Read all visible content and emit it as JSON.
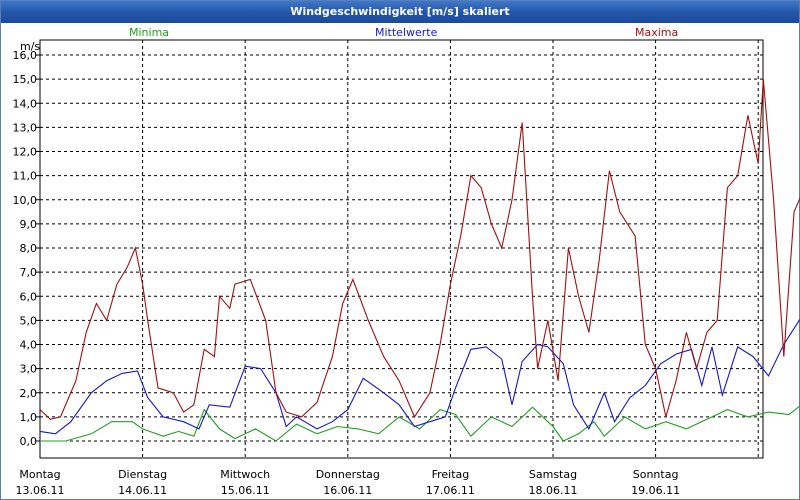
{
  "title": "Windgeschwindigkeit [m/s] skaliert",
  "colors": {
    "min": "#20a020",
    "mean": "#1818c8",
    "max": "#a01010",
    "grid": "#000000",
    "titlebar": "#2456a8"
  },
  "chart_data": {
    "type": "line",
    "title": "Windgeschwindigkeit [m/s] skaliert",
    "ylabel": "m/s",
    "ylim": [
      -0.8,
      16.5
    ],
    "yticks": [
      "0,0",
      "1,0",
      "2,0",
      "3,0",
      "4,0",
      "5,0",
      "6,0",
      "7,0",
      "8,0",
      "9,0",
      "10,0",
      "11,0",
      "12,0",
      "13,0",
      "14,0",
      "15,0",
      "16,0"
    ],
    "ytick_values": [
      0,
      1,
      2,
      3,
      4,
      5,
      6,
      7,
      8,
      9,
      10,
      11,
      12,
      13,
      14,
      15,
      16
    ],
    "days": [
      {
        "day": "Montag",
        "date": "13.06.11"
      },
      {
        "day": "Dienstag",
        "date": "14.06.11"
      },
      {
        "day": "Mittwoch",
        "date": "15.06.11"
      },
      {
        "day": "Donnerstag",
        "date": "16.06.11"
      },
      {
        "day": "Freitag",
        "date": "17.06.11"
      },
      {
        "day": "Samstag",
        "date": "18.06.11"
      },
      {
        "day": "Sonntag",
        "date": "19.06.11"
      }
    ],
    "x_unit": "days since Montag 13.06.11 00:00",
    "grid": true,
    "legend_position": "top",
    "series": [
      {
        "name": "Minima",
        "color": "#20a020",
        "points": [
          [
            0,
            0
          ],
          [
            0.25,
            0
          ],
          [
            0.5,
            0.3
          ],
          [
            0.7,
            0.8
          ],
          [
            0.9,
            0.8
          ],
          [
            1.0,
            0.5
          ],
          [
            1.2,
            0.2
          ],
          [
            1.35,
            0.4
          ],
          [
            1.5,
            0.2
          ],
          [
            1.6,
            1.3
          ],
          [
            1.75,
            0.5
          ],
          [
            1.9,
            0.1
          ],
          [
            2.1,
            0.5
          ],
          [
            2.3,
            0
          ],
          [
            2.5,
            0.7
          ],
          [
            2.7,
            0.3
          ],
          [
            2.9,
            0.6
          ],
          [
            3.1,
            0.5
          ],
          [
            3.3,
            0.3
          ],
          [
            3.5,
            1.0
          ],
          [
            3.7,
            0.5
          ],
          [
            3.9,
            1.3
          ],
          [
            4.05,
            1.1
          ],
          [
            4.2,
            0.2
          ],
          [
            4.4,
            1.0
          ],
          [
            4.6,
            0.6
          ],
          [
            4.8,
            1.4
          ],
          [
            5.0,
            0.6
          ],
          [
            5.1,
            0
          ],
          [
            5.25,
            0.3
          ],
          [
            5.4,
            0.8
          ],
          [
            5.5,
            0.2
          ],
          [
            5.7,
            1.0
          ],
          [
            5.9,
            0.5
          ],
          [
            6.1,
            0.8
          ],
          [
            6.3,
            0.5
          ],
          [
            6.5,
            0.9
          ],
          [
            6.7,
            1.3
          ],
          [
            6.9,
            1.0
          ],
          [
            7.1,
            1.2
          ],
          [
            7.3,
            1.1
          ],
          [
            7.45,
            1.6
          ],
          [
            7.6,
            1.5
          ]
        ]
      },
      {
        "name": "Mittelwerte",
        "color": "#1818c8",
        "points": [
          [
            0,
            0.4
          ],
          [
            0.15,
            0.3
          ],
          [
            0.3,
            0.8
          ],
          [
            0.5,
            2.0
          ],
          [
            0.65,
            2.5
          ],
          [
            0.8,
            2.8
          ],
          [
            0.95,
            2.9
          ],
          [
            1.05,
            1.8
          ],
          [
            1.2,
            1.0
          ],
          [
            1.4,
            0.8
          ],
          [
            1.55,
            0.5
          ],
          [
            1.65,
            1.5
          ],
          [
            1.85,
            1.4
          ],
          [
            2.0,
            3.1
          ],
          [
            2.15,
            3.0
          ],
          [
            2.3,
            2.0
          ],
          [
            2.4,
            0.6
          ],
          [
            2.5,
            1.0
          ],
          [
            2.7,
            0.5
          ],
          [
            2.85,
            0.8
          ],
          [
            3.0,
            1.3
          ],
          [
            3.15,
            2.6
          ],
          [
            3.35,
            2.0
          ],
          [
            3.5,
            1.5
          ],
          [
            3.65,
            0.6
          ],
          [
            3.8,
            0.8
          ],
          [
            3.95,
            1.0
          ],
          [
            4.05,
            2.2
          ],
          [
            4.2,
            3.8
          ],
          [
            4.35,
            3.9
          ],
          [
            4.5,
            3.4
          ],
          [
            4.6,
            1.5
          ],
          [
            4.7,
            3.3
          ],
          [
            4.85,
            4.0
          ],
          [
            4.95,
            3.9
          ],
          [
            5.1,
            3.2
          ],
          [
            5.2,
            1.5
          ],
          [
            5.35,
            0.5
          ],
          [
            5.5,
            2.0
          ],
          [
            5.6,
            0.8
          ],
          [
            5.75,
            1.8
          ],
          [
            5.9,
            2.3
          ],
          [
            6.05,
            3.2
          ],
          [
            6.2,
            3.6
          ],
          [
            6.35,
            3.8
          ],
          [
            6.45,
            2.3
          ],
          [
            6.55,
            3.9
          ],
          [
            6.65,
            1.9
          ],
          [
            6.8,
            3.9
          ],
          [
            6.95,
            3.5
          ],
          [
            7.1,
            2.7
          ],
          [
            7.25,
            4.0
          ],
          [
            7.4,
            5.0
          ],
          [
            7.55,
            5.5
          ],
          [
            7.65,
            3.9
          ],
          [
            7.8,
            4.5
          ],
          [
            7.95,
            4.8
          ],
          [
            8.1,
            3.7
          ]
        ]
      },
      {
        "name": "Maxima",
        "color": "#a01010",
        "points": [
          [
            0,
            1.3
          ],
          [
            0.1,
            0.9
          ],
          [
            0.2,
            1.0
          ],
          [
            0.35,
            2.5
          ],
          [
            0.45,
            4.5
          ],
          [
            0.55,
            5.7
          ],
          [
            0.65,
            5.0
          ],
          [
            0.75,
            6.5
          ],
          [
            0.85,
            7.2
          ],
          [
            0.93,
            8.0
          ],
          [
            1.0,
            6.5
          ],
          [
            1.05,
            5.0
          ],
          [
            1.15,
            2.2
          ],
          [
            1.3,
            2.0
          ],
          [
            1.4,
            1.2
          ],
          [
            1.5,
            1.5
          ],
          [
            1.6,
            3.8
          ],
          [
            1.7,
            3.5
          ],
          [
            1.75,
            6.0
          ],
          [
            1.85,
            5.5
          ],
          [
            1.9,
            6.5
          ],
          [
            2.05,
            6.7
          ],
          [
            2.2,
            5.0
          ],
          [
            2.3,
            2.0
          ],
          [
            2.4,
            1.2
          ],
          [
            2.55,
            1.0
          ],
          [
            2.7,
            1.6
          ],
          [
            2.85,
            3.5
          ],
          [
            2.95,
            5.7
          ],
          [
            3.05,
            6.7
          ],
          [
            3.2,
            5.0
          ],
          [
            3.35,
            3.5
          ],
          [
            3.5,
            2.5
          ],
          [
            3.65,
            1.0
          ],
          [
            3.8,
            2.0
          ],
          [
            3.9,
            4.0
          ],
          [
            4.0,
            6.5
          ],
          [
            4.1,
            8.5
          ],
          [
            4.2,
            11.0
          ],
          [
            4.3,
            10.5
          ],
          [
            4.4,
            9.0
          ],
          [
            4.5,
            8.0
          ],
          [
            4.6,
            10.0
          ],
          [
            4.7,
            13.2
          ],
          [
            4.8,
            6.0
          ],
          [
            4.85,
            3.0
          ],
          [
            4.95,
            5.0
          ],
          [
            5.05,
            2.5
          ],
          [
            5.15,
            8.0
          ],
          [
            5.25,
            6.0
          ],
          [
            5.35,
            4.5
          ],
          [
            5.45,
            7.5
          ],
          [
            5.55,
            11.2
          ],
          [
            5.65,
            9.5
          ],
          [
            5.8,
            8.5
          ],
          [
            5.9,
            4.0
          ],
          [
            6.0,
            3.0
          ],
          [
            6.1,
            1.0
          ],
          [
            6.2,
            2.5
          ],
          [
            6.3,
            4.5
          ],
          [
            6.4,
            3.0
          ],
          [
            6.5,
            4.5
          ],
          [
            6.6,
            5.0
          ],
          [
            6.7,
            10.5
          ],
          [
            6.8,
            11.0
          ],
          [
            6.9,
            13.5
          ],
          [
            7.0,
            11.5
          ],
          [
            7.05,
            15.0
          ],
          [
            7.15,
            10.0
          ],
          [
            7.25,
            3.5
          ],
          [
            7.35,
            9.5
          ],
          [
            7.45,
            10.5
          ],
          [
            7.55,
            6.5
          ],
          [
            7.6,
            3.0
          ],
          [
            7.7,
            5.5
          ],
          [
            7.8,
            10.0
          ],
          [
            7.9,
            9.5
          ],
          [
            8.0,
            7.0
          ],
          [
            8.1,
            11.0
          ],
          [
            8.2,
            9.0
          ],
          [
            8.3,
            12.5
          ],
          [
            8.4,
            10.0
          ],
          [
            8.5,
            15.0
          ],
          [
            8.55,
            15.8
          ],
          [
            8.65,
            11.5
          ],
          [
            8.75,
            12.8
          ],
          [
            8.85,
            11.5
          ],
          [
            8.95,
            9.0
          ],
          [
            9.05,
            11.0
          ],
          [
            9.15,
            11.5
          ],
          [
            9.25,
            10.0
          ],
          [
            9.35,
            8.4
          ],
          [
            9.45,
            8.4
          ]
        ]
      }
    ]
  }
}
